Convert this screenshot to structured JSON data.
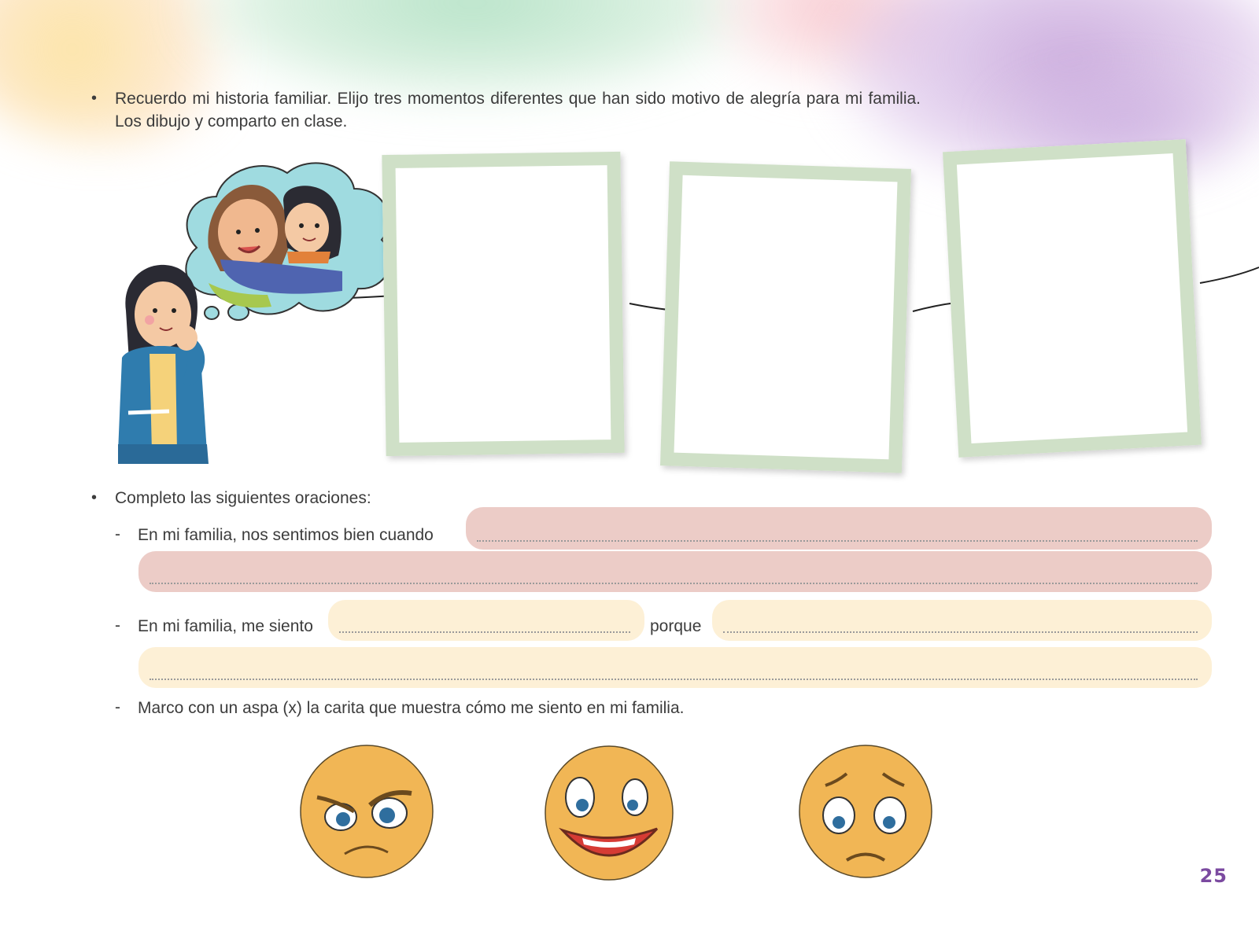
{
  "activity1": {
    "bullet": "•",
    "instruction": "Recuerdo mi historia familiar. Elijo tres momentos diferentes que han sido motivo de alegría para mi familia. Los dibujo y comparto en clase."
  },
  "activity2": {
    "bullet": "•",
    "instruction": "Completo las siguientes oraciones:",
    "items": [
      {
        "dash": "-",
        "text": "En mi familia, nos sentimos bien cuando"
      },
      {
        "dash": "-",
        "text": "En mi familia, me siento",
        "connector": "porque"
      },
      {
        "dash": "-",
        "text": "Marco con un aspa (x) la carita que muestra cómo me siento en mi familia."
      }
    ]
  },
  "faces": [
    "angry-face-icon",
    "happy-face-icon",
    "sad-face-icon"
  ],
  "colors": {
    "frame": "#cfe0c7",
    "lane_pink": "#ecccc7",
    "lane_cream": "#fdf0d6",
    "face": "#f1b655",
    "page_number": "#7b4aa0"
  },
  "page_number": "25"
}
